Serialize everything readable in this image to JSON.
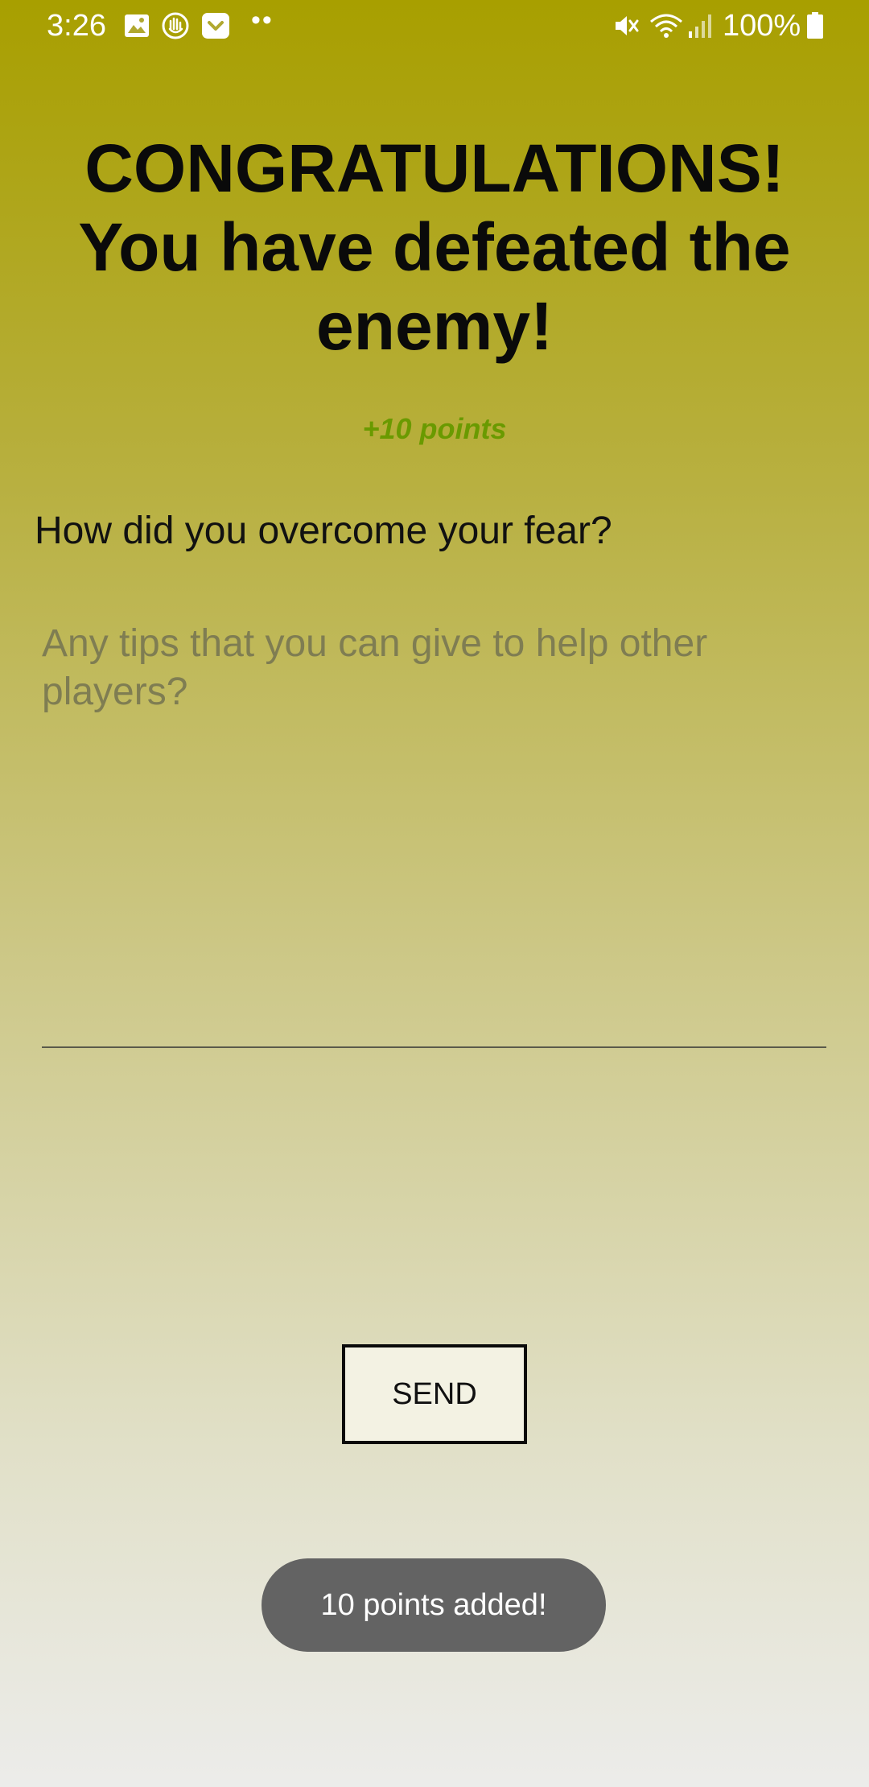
{
  "status_bar": {
    "time": "3:26",
    "notification_icons": [
      "image-icon",
      "hand-icon",
      "pocket-icon"
    ],
    "overflow": "••",
    "system_icons": [
      "mute-icon",
      "wifi-icon",
      "signal-icon",
      "battery-icon"
    ],
    "battery": "100%"
  },
  "screen": {
    "title": "CONGRATULATIONS! You have defeated the enemy!",
    "points_awarded": "+10 points",
    "question": "How did you overcome your fear?",
    "tips_input": {
      "value": "",
      "placeholder": "Any tips that you can give to help other players?"
    },
    "send_label": "SEND"
  },
  "toast": {
    "message": "10 points added!"
  },
  "colors": {
    "background_top": "#a89f00",
    "background_bottom": "#ececea",
    "points_accent": "#6a9a00",
    "toast_bg": "#636363"
  }
}
